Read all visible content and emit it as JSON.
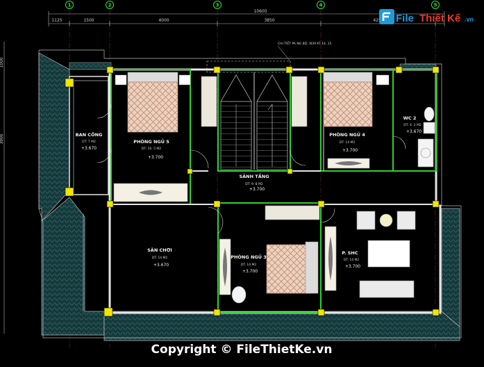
{
  "axes": [
    "1",
    "2",
    "3",
    "4",
    "5"
  ],
  "dimensions": {
    "total": "10600",
    "d1": "1125",
    "d2": "1500",
    "d3": "4000",
    "d4": "3850",
    "d5": "4250",
    "left_mark": "1000",
    "left_mid": "3900"
  },
  "note_text": "CHI TIẾT PA NG BỘ, XEM KT 14, 15",
  "rooms": [
    {
      "name": "BAN CÔNG",
      "area": "DT: 7 M2",
      "level": "+3.670"
    },
    {
      "name": "PHÒNG NGỦ 5",
      "area": "DT: 16. 5 M2",
      "level": "+3.700"
    },
    {
      "name": "PHÒNG NGỦ 4",
      "area": "DT: 14 M2",
      "level": "+3.700"
    },
    {
      "name": "WC 2",
      "area": "DT: 4. 2 M2",
      "level": "+3.670"
    },
    {
      "name": "SẢNH TẦNG",
      "area": "DT: 9. 8 M2",
      "level": "+3.700"
    },
    {
      "name": "SÂN CHƠI",
      "area": "DT: 14 M2",
      "level": "+3.670"
    },
    {
      "name": "PHÒNG NGỦ 3",
      "area": "DT: 14 M2",
      "level": "+3.700"
    },
    {
      "name": "P. SHC",
      "area": "DT: 14 M2",
      "level": "+3.700"
    }
  ],
  "logo": {
    "file": "File",
    "brand": "Thiết Kế",
    "domain": ".vn"
  },
  "copyright": "Copyright © FileThietKe.vn",
  "colors": {
    "background": "#000000",
    "wall_green": "#2fd12f",
    "column_yellow": "#f2e600",
    "roof_teal": "#1f4a4a",
    "bed_pink": "#e9c8b5"
  }
}
